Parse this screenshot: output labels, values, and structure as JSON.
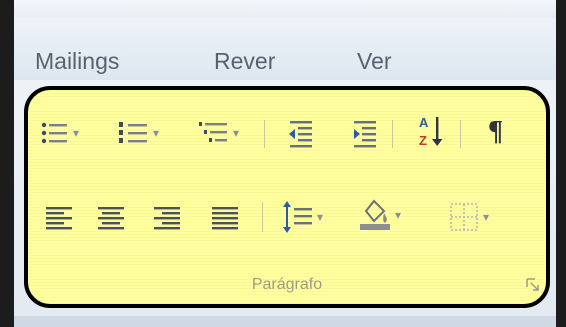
{
  "tabs": [
    {
      "label": "Mailings"
    },
    {
      "label": "Rever"
    },
    {
      "label": "Ver"
    }
  ],
  "group": {
    "label": "Parágrafo",
    "highlight_color": "#ffff9e",
    "row1": [
      {
        "icon": "bullets-icon",
        "dropdown": true
      },
      {
        "icon": "numbering-icon",
        "dropdown": true
      },
      {
        "icon": "multilevel-list-icon",
        "dropdown": true
      },
      {
        "icon": "decrease-indent-icon"
      },
      {
        "icon": "increase-indent-icon"
      },
      {
        "icon": "sort-icon",
        "text": "A Z"
      },
      {
        "icon": "show-formatting-marks-icon",
        "text": "¶"
      }
    ],
    "row2": [
      {
        "icon": "align-left-icon"
      },
      {
        "icon": "align-center-icon"
      },
      {
        "icon": "align-right-icon"
      },
      {
        "icon": "justify-icon"
      },
      {
        "icon": "line-spacing-icon",
        "dropdown": true
      },
      {
        "icon": "shading-icon",
        "dropdown": true
      },
      {
        "icon": "borders-icon",
        "dropdown": true
      }
    ]
  },
  "colors": {
    "frame": "#1c1c1c",
    "ribbon": "#e4eaf1",
    "group_border": "#000000"
  }
}
